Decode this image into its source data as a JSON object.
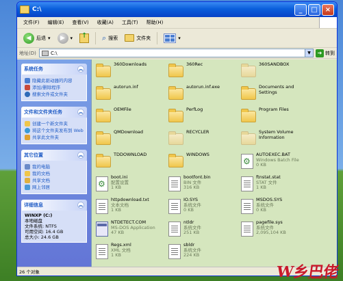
{
  "window": {
    "title": "C:\\"
  },
  "menu": [
    "文件(F)",
    "编辑(E)",
    "查看(V)",
    "收藏(A)",
    "工具(T)",
    "帮助(H)"
  ],
  "toolbar": {
    "back": "后退",
    "search": "搜索",
    "folders": "文件夹"
  },
  "address": {
    "label": "地址(D)",
    "value": "C:\\",
    "go": "转到"
  },
  "sidebar": {
    "system_tasks": {
      "title": "系统任务",
      "items": [
        "隐藏此驱动器的内容",
        "添加/删除程序",
        "搜索文件或文件夹"
      ]
    },
    "file_tasks": {
      "title": "文件和文件夹任务",
      "items": [
        "创建一个新文件夹",
        "将这个文件夹发布到 Web",
        "共享此文件夹"
      ]
    },
    "other_places": {
      "title": "其它位置",
      "items": [
        "我的电脑",
        "我的文档",
        "共享文档",
        "网上邻居"
      ]
    },
    "details": {
      "title": "详细信息",
      "lines": [
        "WINXP (C:)",
        "本地磁盘",
        "文件系统: NTFS",
        "可用空间: 16.4 GB",
        "总大小: 24.6 GB"
      ]
    }
  },
  "files": [
    {
      "name": "360Downloads",
      "sub": "",
      "kind": "folder"
    },
    {
      "name": "360Rec",
      "sub": "",
      "kind": "folder"
    },
    {
      "name": "360SANDBOX",
      "sub": "",
      "kind": "folder-pale"
    },
    {
      "name": "autorun.inf",
      "sub": "",
      "kind": "folder"
    },
    {
      "name": "autorun.inf.exe",
      "sub": "",
      "kind": "folder"
    },
    {
      "name": "Documents and",
      "sub": "Settings",
      "kind": "folder"
    },
    {
      "name": "OEMFile",
      "sub": "",
      "kind": "folder"
    },
    {
      "name": "PerfLog",
      "sub": "",
      "kind": "folder"
    },
    {
      "name": "Program Files",
      "sub": "",
      "kind": "folder"
    },
    {
      "name": "QMDownload",
      "sub": "",
      "kind": "folder"
    },
    {
      "name": "RECYCLER",
      "sub": "",
      "kind": "folder-pale"
    },
    {
      "name": "System Volume",
      "sub": "Information",
      "kind": "folder-pale"
    },
    {
      "name": "TDDOWNLOAD",
      "sub": "",
      "kind": "folder"
    },
    {
      "name": "WINDOWS",
      "sub": "",
      "kind": "folder"
    },
    {
      "name": "AUTOEXEC.BAT",
      "sub": "Windows Batch File",
      "sub2": "0 KB",
      "kind": "gear"
    },
    {
      "name": "boot.ini",
      "sub": "配置设置",
      "sub2": "1 KB",
      "kind": "gear"
    },
    {
      "name": "bootfont.bin",
      "sub": "BIN 文件",
      "sub2": "316 KB",
      "kind": "doc"
    },
    {
      "name": "ftnstat.stat",
      "sub": "STAT 文件",
      "sub2": "1 KB",
      "kind": "doc"
    },
    {
      "name": "httpdownload.txt",
      "sub": "文本文档",
      "sub2": "1 KB",
      "kind": "doc"
    },
    {
      "name": "IO.SYS",
      "sub": "系统文件",
      "sub2": "0 KB",
      "kind": "doc"
    },
    {
      "name": "MSDOS.SYS",
      "sub": "系统文件",
      "sub2": "0 KB",
      "kind": "doc"
    },
    {
      "name": "NTDETECT.COM",
      "sub": "MS-DOS Application",
      "sub2": "47 KB",
      "kind": "app"
    },
    {
      "name": "ntldr",
      "sub": "系统文件",
      "sub2": "251 KB",
      "kind": "doc"
    },
    {
      "name": "pagefile.sys",
      "sub": "系统文件",
      "sub2": "2,095,104 KB",
      "kind": "doc"
    },
    {
      "name": "Regs.xml",
      "sub": "XML 文档",
      "sub2": "1 KB",
      "kind": "doc"
    },
    {
      "name": "sbldr",
      "sub": "系统文件",
      "sub2": "224 KB",
      "kind": "doc"
    }
  ],
  "status": {
    "count": "26 个对象"
  },
  "watermark": {
    "brand": "W乡巴佬",
    "url": "www.30in.com"
  }
}
